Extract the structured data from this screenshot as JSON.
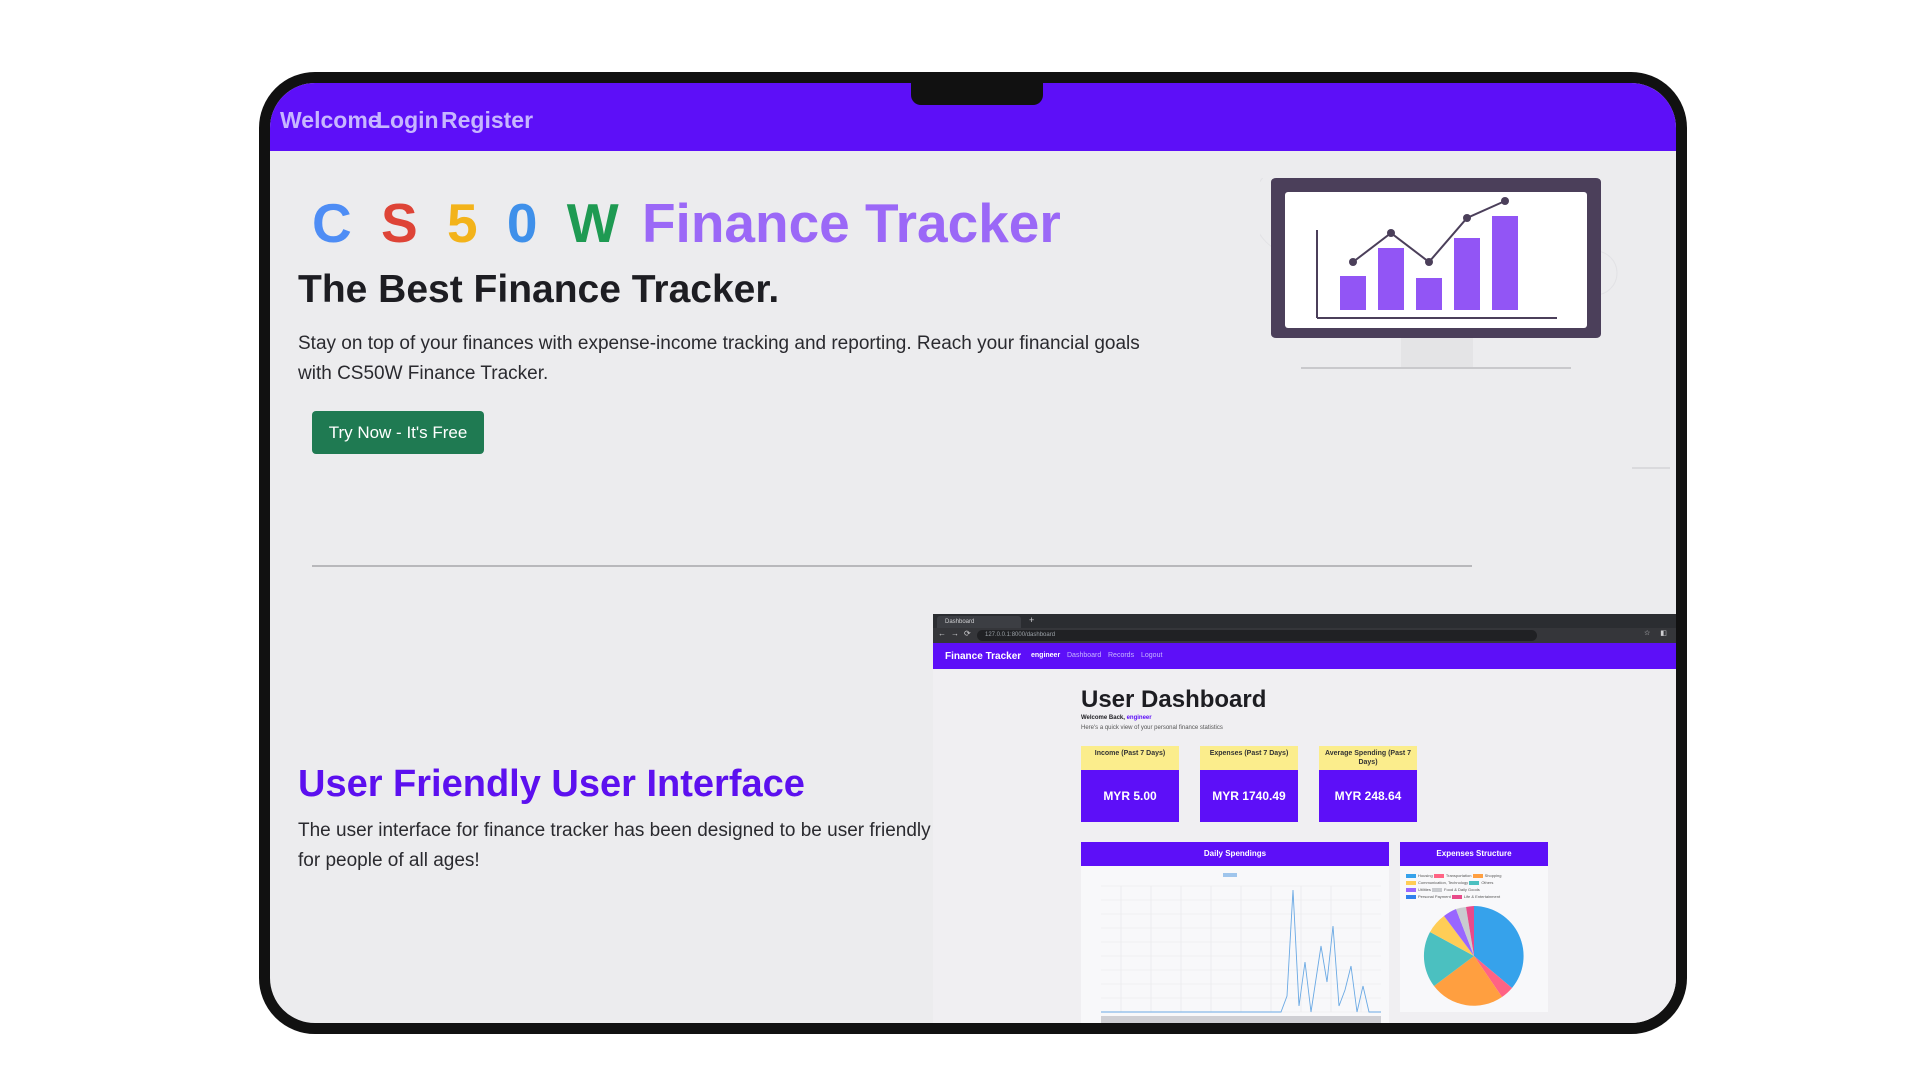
{
  "nav": {
    "items": [
      "Welcome",
      "Login",
      "Register"
    ]
  },
  "hero": {
    "title_letters": [
      "C",
      "S",
      "5",
      "0",
      "W"
    ],
    "title_rest": "Finance Tracker",
    "headline": "The Best Finance Tracker.",
    "subtext": "Stay on top of your finances with expense-income tracking and reporting. Reach your financial goals with CS50W Finance Tracker.",
    "cta": "Try Now - It's Free"
  },
  "feature": {
    "title": "User Friendly User Interface",
    "text": "The user interface for finance tracker has been designed to be user friendly for people of all ages!"
  },
  "dashboard_screenshot": {
    "tab_title": "Dashboard",
    "url": "127.0.0.1:8000/dashboard",
    "nav_brand": "Finance Tracker",
    "nav_user": "engineer",
    "nav_links": [
      "Dashboard",
      "Records",
      "Logout"
    ],
    "title": "User Dashboard",
    "welcome_prefix": "Welcome Back,",
    "welcome_user": "engineer",
    "welcome_sub": "Here's a quick view of your personal finance statistics",
    "stats": [
      {
        "label": "Income (Past 7 Days)",
        "value": "MYR 5.00"
      },
      {
        "label": "Expenses (Past 7 Days)",
        "value": "MYR 1740.49"
      },
      {
        "label": "Average Spending (Past 7 Days)",
        "value": "MYR 248.64"
      }
    ],
    "daily_title": "Daily Spendings",
    "structure_title": "Expenses Structure",
    "structure_legend": [
      "Housing",
      "Transportation",
      "Shopping",
      "Communication, Technology",
      "Others",
      "Utilities",
      "Food & Daily Goods",
      "Personal Payment",
      "Life & Entertainment"
    ],
    "colors": {
      "accent": "#5d0ff8",
      "stat_header": "#fbed8c",
      "cta": "#1f7a52"
    }
  }
}
